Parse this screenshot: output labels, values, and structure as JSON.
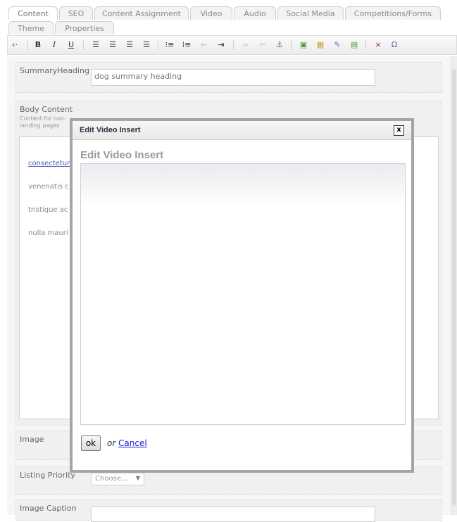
{
  "tabs_row1": [
    {
      "label": "Content",
      "active": true
    },
    {
      "label": "SEO",
      "active": false
    },
    {
      "label": "Content Assignment",
      "active": false
    },
    {
      "label": "Video",
      "active": false
    },
    {
      "label": "Audio",
      "active": false
    },
    {
      "label": "Social Media",
      "active": false
    },
    {
      "label": "Competitions/Forms",
      "active": false
    }
  ],
  "tabs_row2": [
    {
      "label": "Theme",
      "active": false
    },
    {
      "label": "Properties",
      "active": false
    }
  ],
  "toolbar": {
    "bold": "B",
    "italic": "I",
    "underline": "U",
    "special_char": "Ω",
    "remove_format": "×"
  },
  "summary": {
    "label": "SummaryHeading",
    "value": "dog summary heading"
  },
  "body_content": {
    "label": "Body Content",
    "hint_line1": "Content for non-",
    "hint_line2": "landing pages",
    "text_line1": "consectetur",
    "text_line2": "venenatis c",
    "text_line3": "tristique ac",
    "text_line4": "nulla mauri"
  },
  "image": {
    "label": "Image"
  },
  "listing_priority": {
    "label": "Listing Priority",
    "selected": "Choose..."
  },
  "image_caption": {
    "label": "Image Caption"
  },
  "modal": {
    "title": "Edit Video Insert",
    "heading": "Edit Video Insert",
    "close": "x",
    "ok_label": "ok",
    "or_label": "or",
    "cancel_label": "Cancel"
  }
}
